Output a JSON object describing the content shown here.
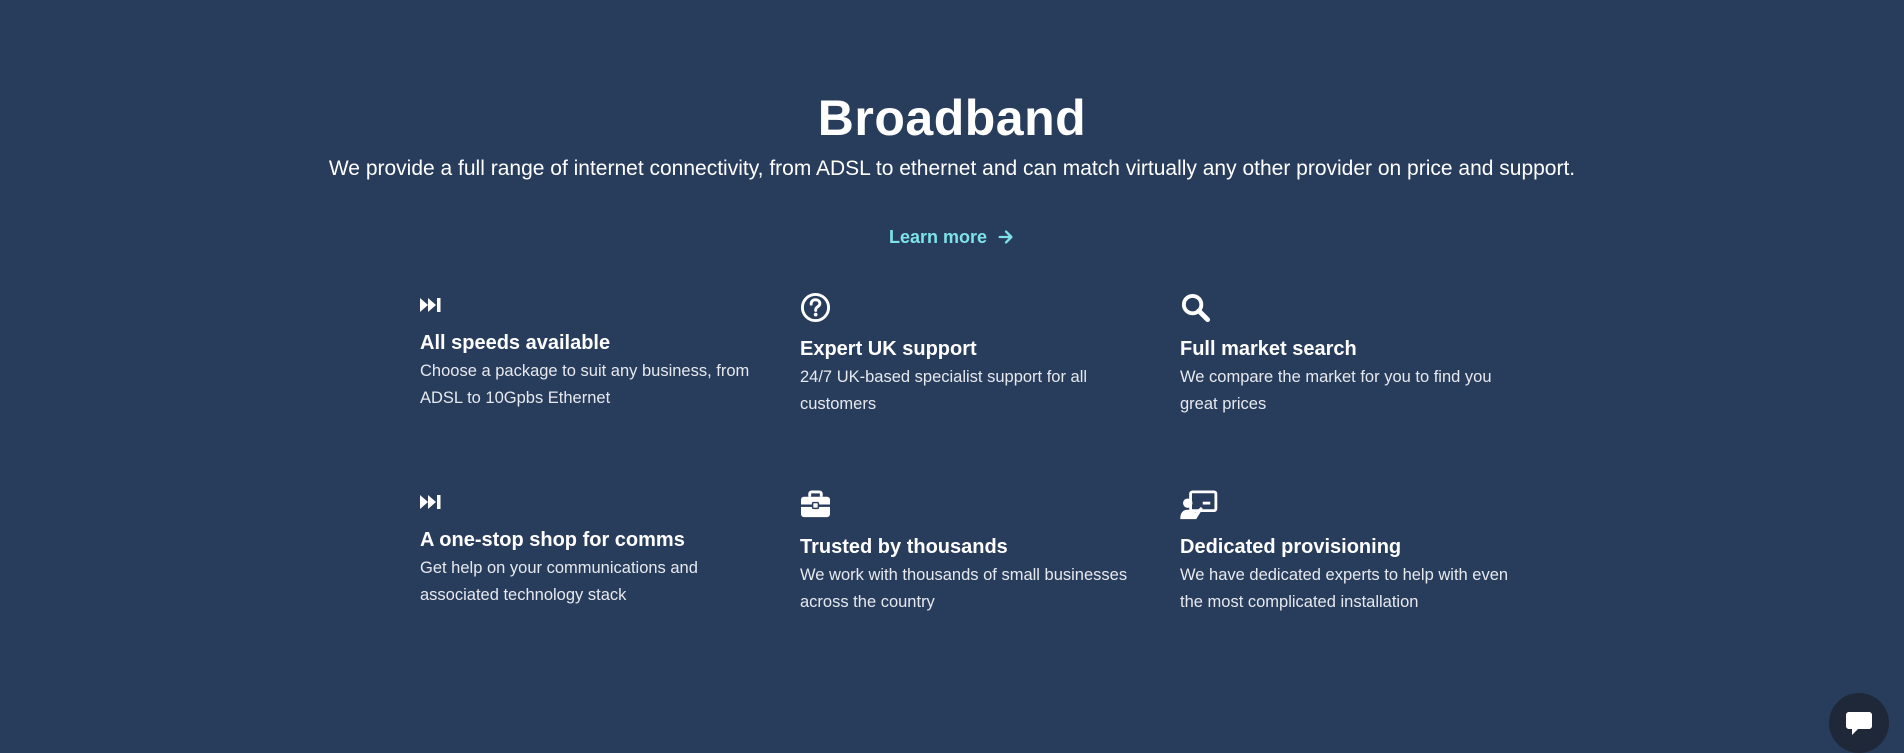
{
  "hero": {
    "title": "Broadband",
    "subtitle": "We provide a full range of internet connectivity, from ADSL to ethernet and can match virtually any other provider on price and support.",
    "learn_more_label": "Learn more"
  },
  "features": [
    {
      "icon": "fast-forward-icon",
      "title": "All speeds available",
      "description": "Choose a package to suit any business, from ADSL to 10Gpbs Ethernet"
    },
    {
      "icon": "question-circle-icon",
      "title": "Expert UK support",
      "description": "24/7 UK-based specialist support for all customers"
    },
    {
      "icon": "search-icon",
      "title": "Full market search",
      "description": "We compare the market for you to find you great prices"
    },
    {
      "icon": "fast-forward-icon",
      "title": "A one-stop shop for comms",
      "description": "Get help on your communications and associated technology stack"
    },
    {
      "icon": "briefcase-icon",
      "title": "Trusted by thousands",
      "description": "We work with thousands of small businesses across the country"
    },
    {
      "icon": "presenter-icon",
      "title": "Dedicated provisioning",
      "description": "We have dedicated experts to help with even the most complicated installation"
    }
  ],
  "chat": {
    "icon": "chat-bubble-icon"
  },
  "colors": {
    "background": "#283c5c",
    "accent": "#7de3e8",
    "text": "#ffffff",
    "chat_button": "#1f2838"
  }
}
